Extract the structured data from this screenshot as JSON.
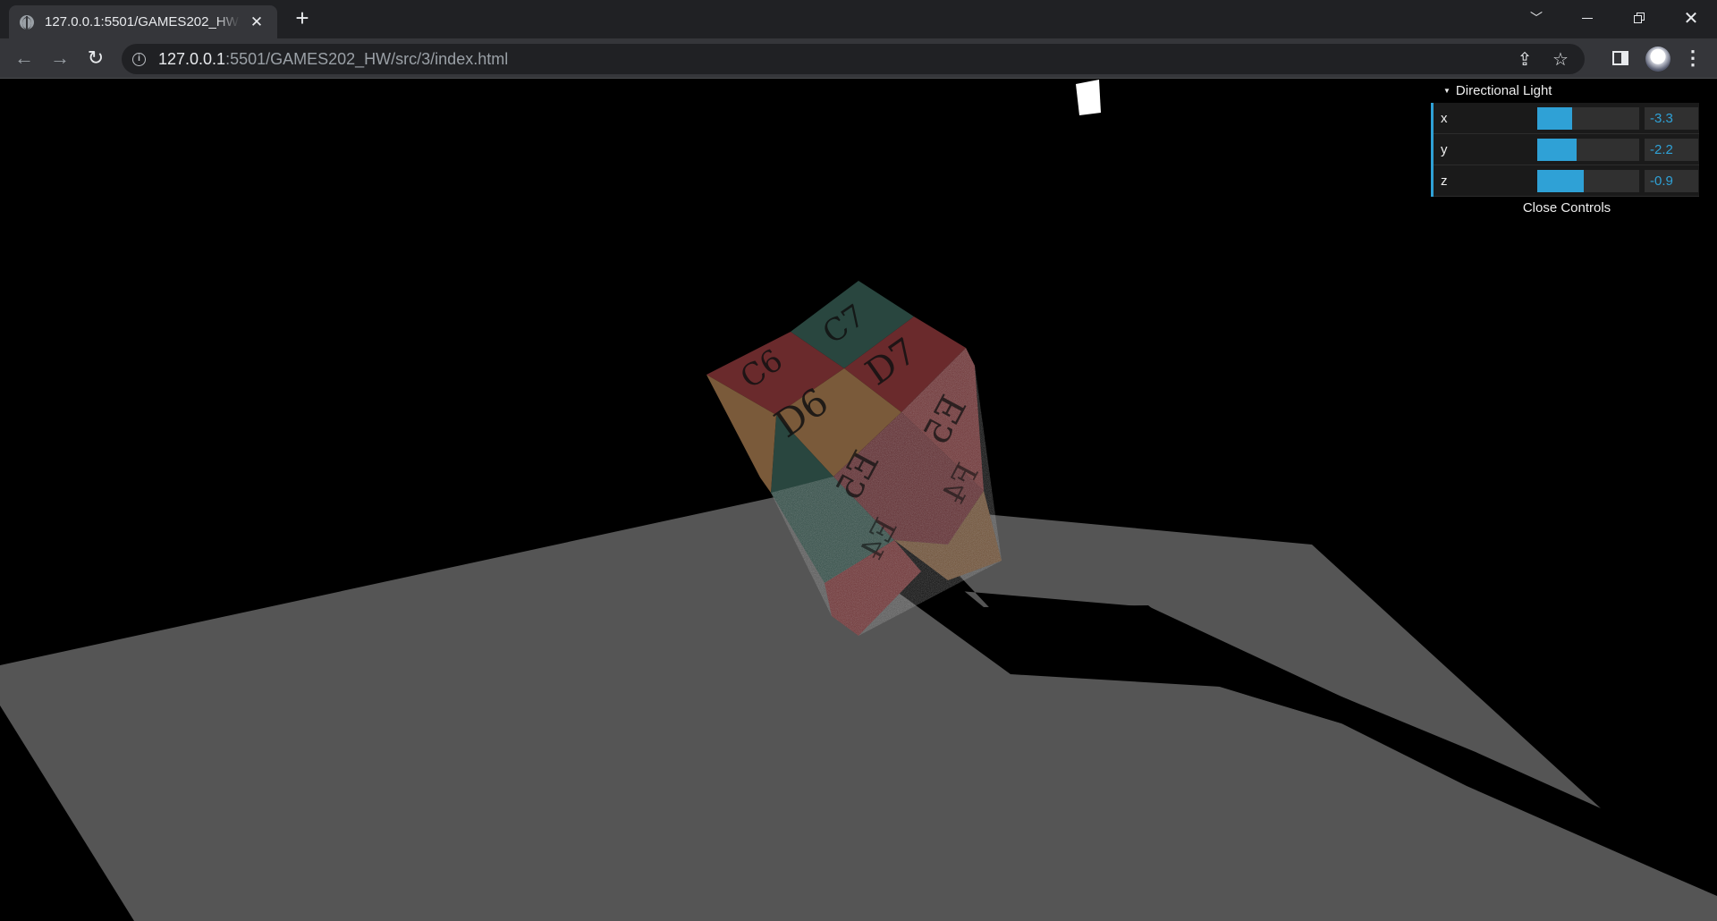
{
  "browser": {
    "tab_title": "127.0.0.1:5501/GAMES202_HW/src/3/index.html",
    "url_host": "127.0.0.1",
    "url_path": ":5501/GAMES202_HW/src/3/index.html"
  },
  "gui": {
    "folder_title": "Directional Light",
    "close_label": "Close Controls",
    "controls": [
      {
        "label": "x",
        "value": "-3.3",
        "fill": 0.34
      },
      {
        "label": "y",
        "value": "-2.2",
        "fill": 0.39
      },
      {
        "label": "z",
        "value": "-0.9",
        "fill": 0.46
      }
    ]
  },
  "cube": {
    "labels": [
      "C7",
      "C6",
      "D7",
      "D6",
      "E5",
      "E5",
      "E4",
      "F4"
    ],
    "colors": {
      "teal": "#29463f",
      "red": "#6a2a2c",
      "orange": "#7a5a3a",
      "floor": "#555555"
    }
  }
}
